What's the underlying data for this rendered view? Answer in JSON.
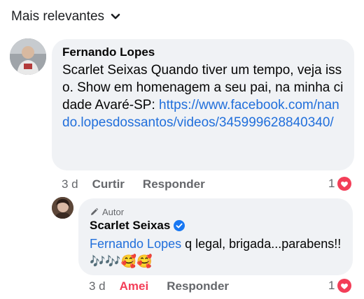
{
  "sort": {
    "label": "Mais relevantes",
    "icon": "chevron-down-icon"
  },
  "comments": [
    {
      "author": "Fernando Lopes",
      "text": "Scarlet Seixas Quando tiver um tempo, veja isso. Show em homenagem a seu pai, na minha cidade Avaré-SP: ",
      "link": "https://www.facebook.com/nando.lopesdossantos/videos/345999628840340/",
      "time": "3 d",
      "like_label": "Curtir",
      "reply_label": "Responder",
      "reaction_count": "1",
      "reaction_icon": "love-reaction-icon"
    }
  ],
  "reply": {
    "role_label": "Autor",
    "role_icon": "pencil-icon",
    "author": "Scarlet Seixas",
    "verified_icon": "verified-badge-icon",
    "mention": "Fernando Lopes",
    "text": " q legal, brigada...parabens!!🎶🎶🥰🥰",
    "time": "3 d",
    "like_label": "Amei",
    "reply_label": "Responder",
    "reaction_count": "1",
    "reaction_icon": "love-reaction-icon"
  },
  "colors": {
    "link": "#216fdb",
    "liked": "#f33e58",
    "bubble": "#f0f2f5",
    "muted": "#65676b"
  }
}
